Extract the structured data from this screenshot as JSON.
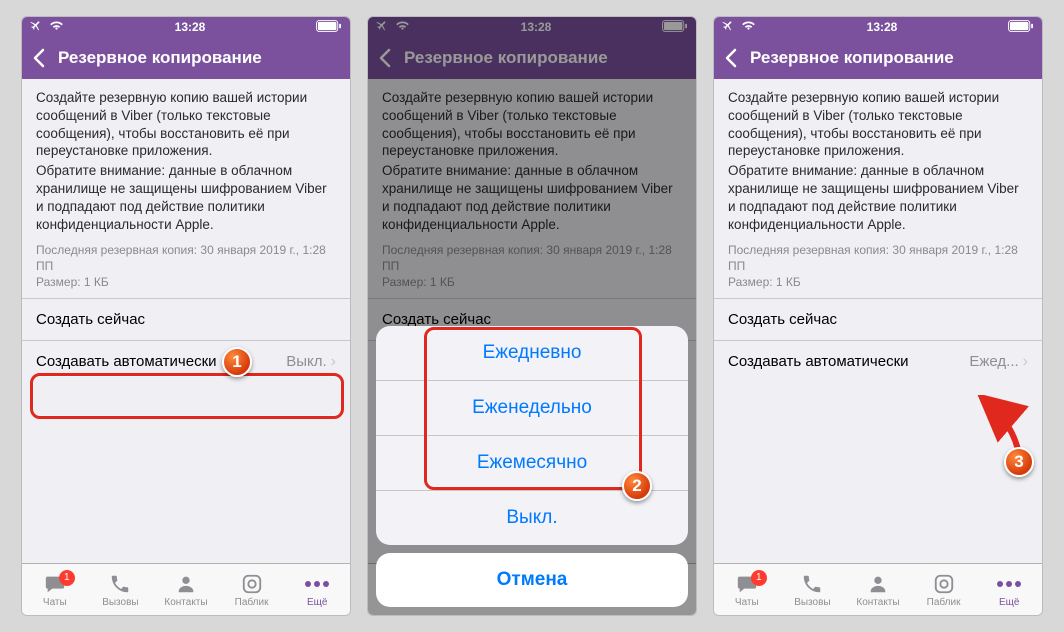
{
  "status": {
    "time": "13:28"
  },
  "nav": {
    "title": "Резервное копирование"
  },
  "desc": {
    "line1": "Создайте резервную копию вашей истории сообщений в Viber (только текстовые сообщения), чтобы восстановить её при переустановке приложения.",
    "line2": "Обратите внимание: данные в облачном хранилище не защищены шифрованием Viber и подпадают под действие политики конфиденциальности Apple."
  },
  "lastBackup": {
    "line1": "Последняя резервная копия: 30 января 2019 г., 1:28 ПП",
    "line2": "Размер: 1 КБ"
  },
  "rows": {
    "createNow": "Создать сейчас",
    "autoLabel": "Создавать автоматически",
    "autoValueOff": "Выкл.",
    "autoValueDaily": "Ежед..."
  },
  "sheet": {
    "daily": "Ежедневно",
    "weekly": "Еженедельно",
    "monthly": "Ежемесячно",
    "off": "Выкл.",
    "cancel": "Отмена"
  },
  "tabs": {
    "chats": "Чаты",
    "calls": "Вызовы",
    "contacts": "Контакты",
    "public": "Паблик",
    "more": "Ещё",
    "chats_badge": "1"
  },
  "markers": {
    "m1": "1",
    "m2": "2",
    "m3": "3"
  }
}
